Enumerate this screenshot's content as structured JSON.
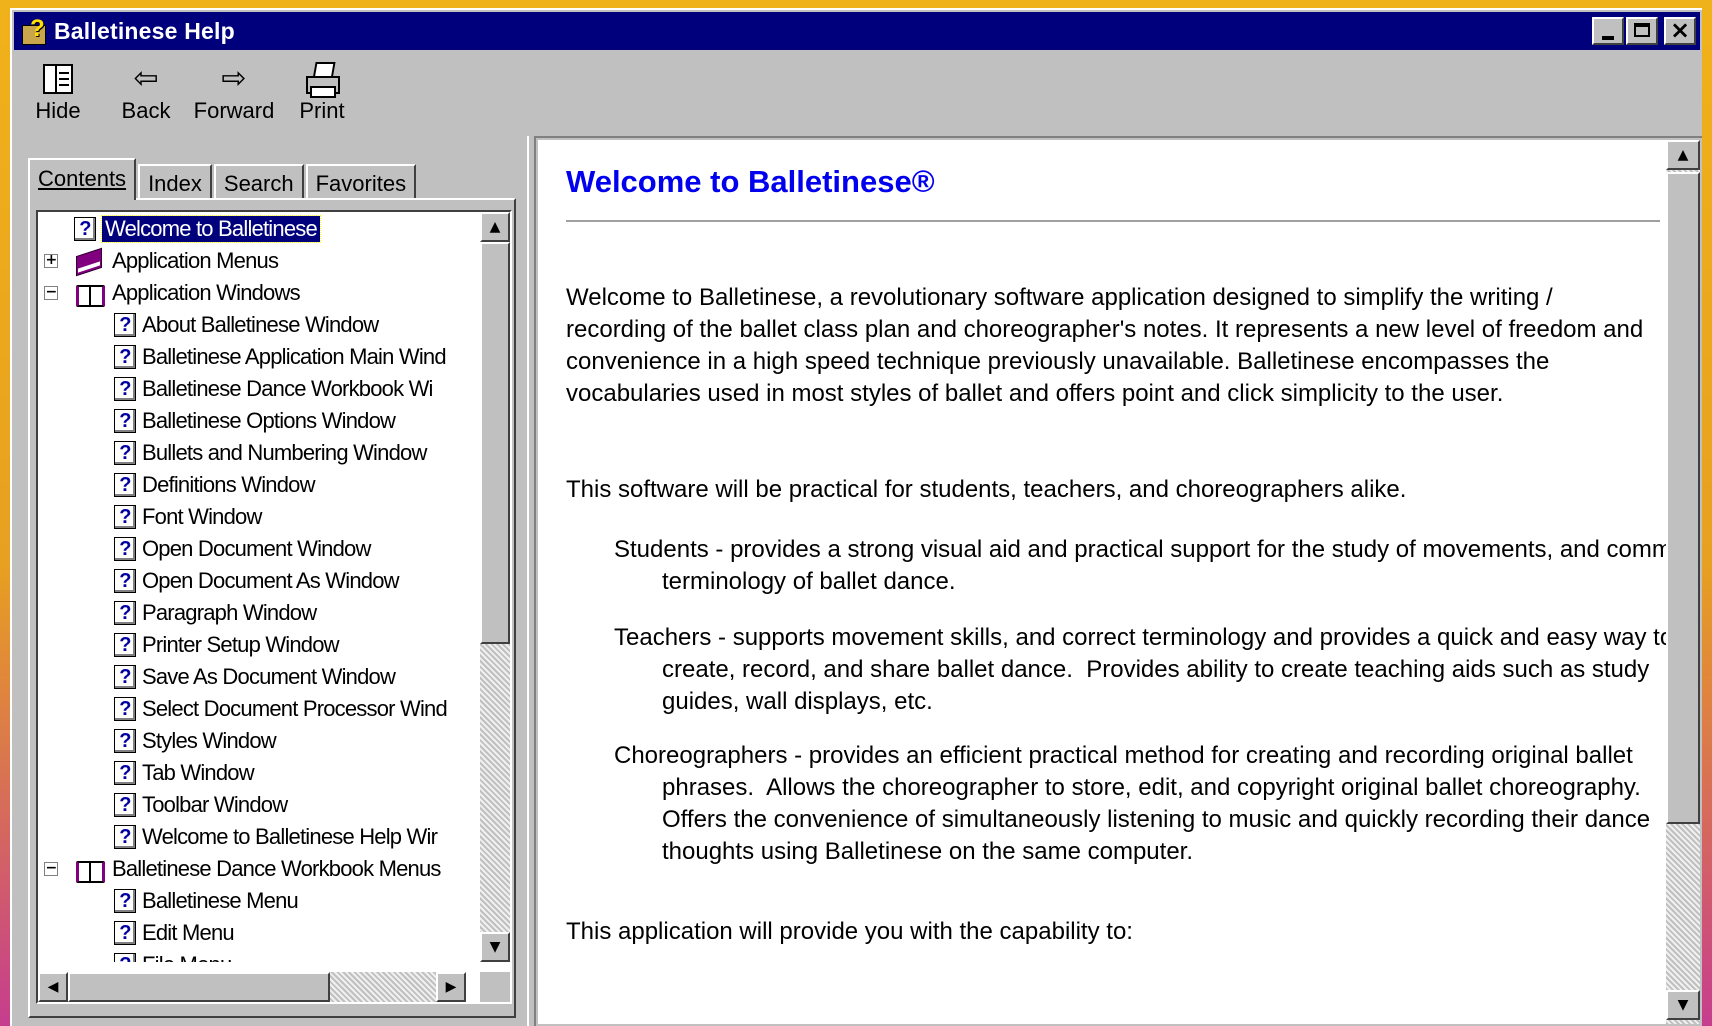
{
  "window": {
    "title": "Balletinese Help",
    "controls": [
      "minimize",
      "maximize",
      "close"
    ]
  },
  "toolbar": {
    "hide_label": "Hide",
    "back_label": "Back",
    "forward_label": "Forward",
    "print_label": "Print"
  },
  "tabs": {
    "contents": "Contents",
    "index": "Index",
    "search": "Search",
    "favorites": "Favorites",
    "active": "Contents"
  },
  "tree": {
    "items": [
      {
        "label": "Welcome to Balletinese",
        "icon": "help-page-icon",
        "level": 0,
        "selected": true
      },
      {
        "label": "Application Menus",
        "icon": "book-closed-icon",
        "level": 0,
        "expander": "+"
      },
      {
        "label": "Application Windows",
        "icon": "book-open-icon",
        "level": 0,
        "expander": "−"
      },
      {
        "label": "About Balletinese Window",
        "icon": "help-page-icon",
        "level": 1
      },
      {
        "label": "Balletinese Application Main Wind",
        "icon": "help-page-icon",
        "level": 1
      },
      {
        "label": "Balletinese Dance Workbook Wi",
        "icon": "help-page-icon",
        "level": 1
      },
      {
        "label": "Balletinese Options Window",
        "icon": "help-page-icon",
        "level": 1
      },
      {
        "label": "Bullets and Numbering Window",
        "icon": "help-page-icon",
        "level": 1
      },
      {
        "label": "Definitions Window",
        "icon": "help-page-icon",
        "level": 1
      },
      {
        "label": "Font Window",
        "icon": "help-page-icon",
        "level": 1
      },
      {
        "label": "Open Document Window",
        "icon": "help-page-icon",
        "level": 1
      },
      {
        "label": "Open Document As Window",
        "icon": "help-page-icon",
        "level": 1
      },
      {
        "label": "Paragraph Window",
        "icon": "help-page-icon",
        "level": 1
      },
      {
        "label": "Printer Setup Window",
        "icon": "help-page-icon",
        "level": 1
      },
      {
        "label": "Save As Document Window",
        "icon": "help-page-icon",
        "level": 1
      },
      {
        "label": "Select Document Processor Wind",
        "icon": "help-page-icon",
        "level": 1
      },
      {
        "label": "Styles Window",
        "icon": "help-page-icon",
        "level": 1
      },
      {
        "label": "Tab Window",
        "icon": "help-page-icon",
        "level": 1
      },
      {
        "label": "Toolbar Window",
        "icon": "help-page-icon",
        "level": 1
      },
      {
        "label": "Welcome to Balletinese Help Wir",
        "icon": "help-page-icon",
        "level": 1
      },
      {
        "label": "Balletinese Dance Workbook Menus",
        "icon": "book-open-icon",
        "level": 0,
        "expander": "−"
      },
      {
        "label": "Balletinese Menu",
        "icon": "help-page-icon",
        "level": 1
      },
      {
        "label": "Edit Menu",
        "icon": "help-page-icon",
        "level": 1
      },
      {
        "label": "File Menu",
        "icon": "help-page-icon",
        "level": 1
      }
    ]
  },
  "content": {
    "heading": "Welcome to Balletinese®",
    "intro": "Welcome to Balletinese, a revolutionary software application designed to simplify the writing / recording of the ballet class plan and choreographer's notes. It represents a new level of freedom and convenience in a high speed technique previously unavailable. Balletinese encompasses the vocabularies used in most styles of ballet and offers point and click simplicity to the user.",
    "practical": "This software will be practical for students, teachers, and choreographers alike.",
    "students": "Students - provides a strong visual aid and practical support for the study of movements, and common terminology of ballet dance.",
    "teachers": "Teachers - supports movement skills, and correct terminology and provides a quick and easy way to create, record, and share ballet dance.  Provides ability to create teaching aids such as study guides, wall displays, etc.",
    "choreographers": "Choreographers - provides an efficient practical method for creating and recording original ballet phrases.  Allows the choreographer to store, edit, and copyright original ballet choreography.  Offers the convenience of simultaneously listening to music and quickly recording their dance thoughts using Balletinese on the same computer.",
    "capability": "This application will provide you with the capability to:"
  },
  "colors": {
    "titlebar": "#00007c",
    "heading": "#0000ee",
    "face": "#c0c0c0"
  }
}
